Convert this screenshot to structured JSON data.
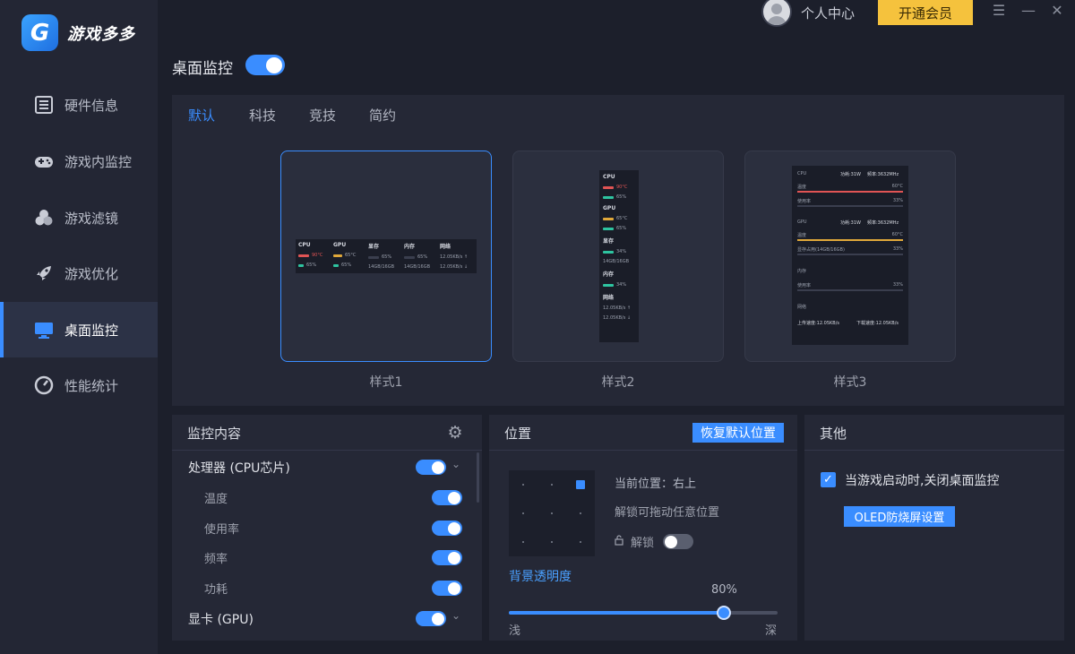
{
  "app": {
    "name": "游戏多多"
  },
  "header": {
    "user_center": "个人中心",
    "vip_button": "开通会员",
    "menu_glyph": "☰",
    "min_glyph": "—",
    "close_glyph": "✕"
  },
  "sidebar": {
    "items": [
      {
        "label": "硬件信息",
        "icon": "hardware-info-icon"
      },
      {
        "label": "游戏内监控",
        "icon": "gamepad-icon"
      },
      {
        "label": "游戏滤镜",
        "icon": "filter-icon"
      },
      {
        "label": "游戏优化",
        "icon": "rocket-icon"
      },
      {
        "label": "桌面监控",
        "icon": "monitor-icon",
        "active": true
      },
      {
        "label": "性能统计",
        "icon": "gauge-icon"
      }
    ]
  },
  "page": {
    "title": "桌面监控",
    "enabled": true
  },
  "styles": {
    "tabs": [
      "默认",
      "科技",
      "竞技",
      "简约"
    ],
    "active_tab": 0,
    "cards": [
      "样式1",
      "样式2",
      "样式3"
    ],
    "selected": 0,
    "preview": {
      "cpu": "CPU",
      "gpu": "GPU",
      "vram": "显存",
      "ram": "内存",
      "net": "网络",
      "temp_cpu": "90°C",
      "temp_gpu": "65°C",
      "pct": "65%",
      "pct34": "34%",
      "pct33": "33%",
      "vram_size": "14GB/16GB",
      "ram_size": "14GB/16GB",
      "net_up": "12.05KB/s ↑",
      "net_down": "12.05KB/s ↓",
      "power_cpu": "功耗:31W",
      "freq_cpu": "频率:3632MHz",
      "power_gpu": "功耗:31W",
      "freq_gpu": "频率:3632MHz",
      "temp_lbl": "温度",
      "usage_lbl": "使用率",
      "vram_usage_lbl": "显存占用(14GB/16GB)",
      "temp_val": "60°C",
      "ram_lbl": "内存",
      "net_lbl": "网络",
      "up_speed": "上传速度:12.05KB/s",
      "down_speed": "下载速度:12.05KB/s"
    }
  },
  "monitor_panel": {
    "title": "监控内容",
    "rows": [
      {
        "label": "处理器 (CPU芯片)",
        "level": "main",
        "on": true
      },
      {
        "label": "温度",
        "level": "sub",
        "on": true
      },
      {
        "label": "使用率",
        "level": "sub",
        "on": true
      },
      {
        "label": "频率",
        "level": "sub",
        "on": true
      },
      {
        "label": "功耗",
        "level": "sub",
        "on": true
      },
      {
        "label": "显卡 (GPU)",
        "level": "main",
        "on": true
      }
    ]
  },
  "position_panel": {
    "title": "位置",
    "reset_button": "恢复默认位置",
    "current": "当前位置：右上",
    "hint": "解锁可拖动任意位置",
    "lock_label": "解锁",
    "lock_on": false,
    "opacity_label": "背景透明度",
    "opacity_value_text": "80%",
    "opacity_value": 80,
    "slider_min": "浅",
    "slider_max": "深"
  },
  "other_panel": {
    "title": "其他",
    "checkbox_label": "当游戏启动时,关闭桌面监控",
    "checked": true,
    "oled_button": "OLED防烧屏设置"
  },
  "colors": {
    "accent": "#3a8dff",
    "vip": "#f5c23d",
    "bg": "#1c1f2b",
    "panel": "#252836"
  }
}
